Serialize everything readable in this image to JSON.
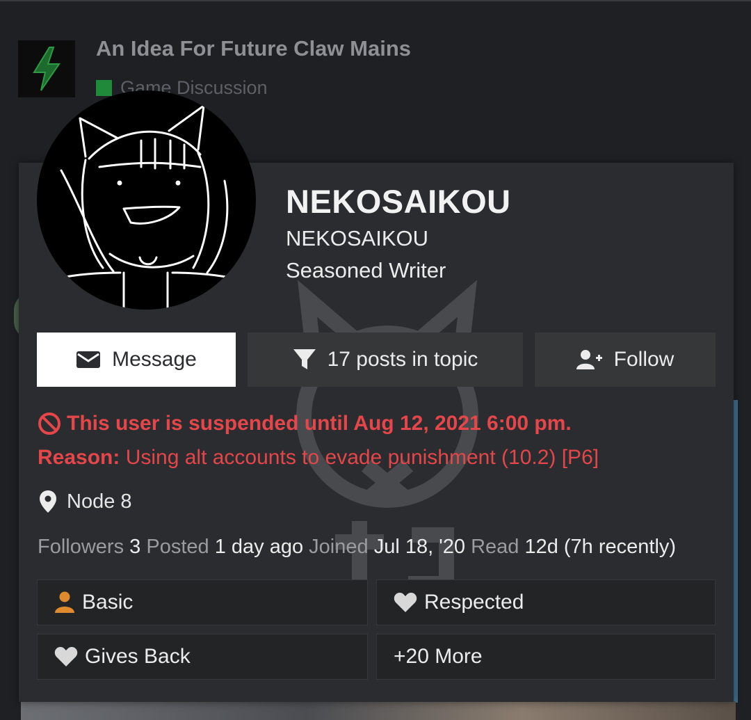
{
  "topic": {
    "title": "An Idea For Future Claw Mains",
    "category": "Game Discussion",
    "category_color": "#1e8a3a"
  },
  "user": {
    "username": "NEKOSAIKOU",
    "name": "NEKOSAIKOU",
    "title": "Seasoned Writer",
    "location": "Node 8"
  },
  "buttons": {
    "message": "Message",
    "filter": "17 posts in topic",
    "follow": "Follow"
  },
  "suspension": {
    "notice": "This user is suspended until Aug 12, 2021 6:00 pm.",
    "reason_label": "Reason:",
    "reason_text": " Using alt accounts to evade punishment (10.2) [P6]",
    "color": "#e4464a"
  },
  "stats": [
    {
      "label": "Followers",
      "value": "3"
    },
    {
      "label": "Posted",
      "value": "1 day ago"
    },
    {
      "label": "Joined",
      "value": "Jul 18, '20"
    },
    {
      "label": "Read",
      "value": "12d (7h recently)"
    }
  ],
  "badges": [
    {
      "label": "Basic",
      "icon": "user-icon",
      "color": "#e08a2e"
    },
    {
      "label": "Respected",
      "icon": "heart-icon",
      "color": "#d8d8d8"
    },
    {
      "label": "Gives Back",
      "icon": "heart-icon",
      "color": "#d8d8d8"
    },
    {
      "label": "+20 More",
      "icon": "",
      "color": ""
    }
  ],
  "icons": {
    "topic_logo": "lightning-bolt-icon",
    "message": "envelope-icon",
    "filter": "filter-icon",
    "follow": "user-plus-icon",
    "suspension": "ban-icon",
    "location": "map-pin-icon"
  }
}
